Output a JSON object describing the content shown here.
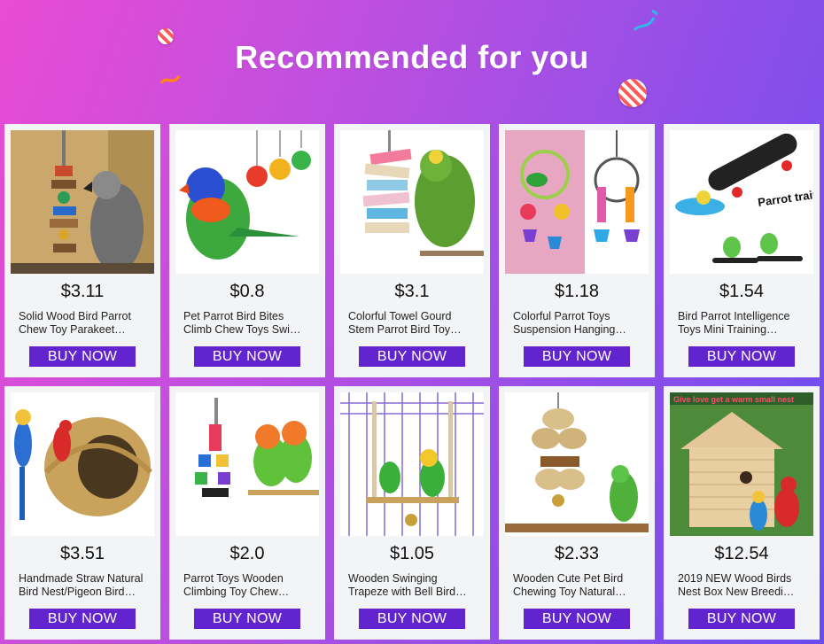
{
  "header": {
    "title": "Recommended for you"
  },
  "products": [
    {
      "price": "$3.11",
      "name": "Solid Wood Bird Parrot Chew Toy Parakeet…",
      "button": "BUY NOW",
      "image": "wooden chew toy with grey parrot"
    },
    {
      "price": "$0.8",
      "name": "Pet Parrot Bird Bites Climb Chew Toys Swi…",
      "button": "BUY NOW",
      "image": "rainbow lorikeet with hanging ball toys"
    },
    {
      "price": "$3.1",
      "name": "Colorful Towel Gourd Stem Parrot Bird Toy…",
      "button": "BUY NOW",
      "image": "loofah stack toy with green parrot"
    },
    {
      "price": "$1.18",
      "name": "Colorful Parrot Toys Suspension Hanging…",
      "button": "BUY NOW",
      "image": "hanging ring toys with bells"
    },
    {
      "price": "$1.54",
      "name": "Bird Parrot Intelligence Toys Mini Training…",
      "button": "BUY NOW",
      "image": "mini skateboard parrot training tool",
      "overlay_text": "Parrot training tool"
    },
    {
      "price": "$3.51",
      "name": "Handmade Straw Natural Bird Nest/Pigeon Bird…",
      "button": "BUY NOW",
      "image": "straw bird nest with macaws"
    },
    {
      "price": "$2.0",
      "name": "Parrot Toys Wooden Climbing Toy Chew…",
      "button": "BUY NOW",
      "image": "colorful wooden block toy with lovebirds"
    },
    {
      "price": "$1.05",
      "name": "Wooden Swinging Trapeze with Bell Bird…",
      "button": "BUY NOW",
      "image": "wooden swing with bell and parrots"
    },
    {
      "price": "$2.33",
      "name": "Wooden Cute Pet Bird Chewing Toy Natural…",
      "button": "BUY NOW",
      "image": "natural woven ball chew toy with parrot"
    },
    {
      "price": "$12.54",
      "name": "2019 NEW Wood Birds Nest Box New Breedi…",
      "button": "BUY NOW",
      "image": "wooden bird house with parrots",
      "overlay_text": "Give love get a warm small nest"
    }
  ],
  "colors": {
    "button": "#6224cf",
    "card": "#f3f4f6",
    "bg_left": "#e94bd4",
    "bg_right": "#6a4cf0"
  }
}
